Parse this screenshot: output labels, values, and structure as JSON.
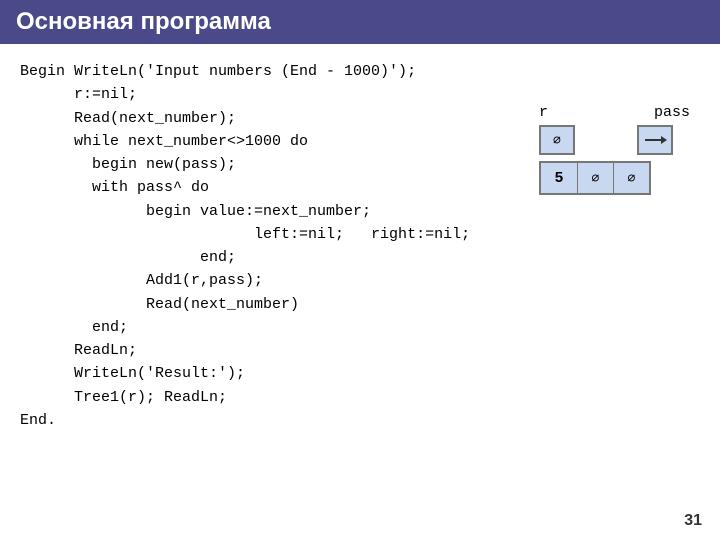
{
  "header": {
    "title": "Основная программа",
    "bg_color": "#4a4a8a"
  },
  "code": {
    "lines": [
      "Begin WriteLn('Input numbers (End - 1000)');",
      "      r:=nil;",
      "      Read(next_number);",
      "      while next_number<>1000 do",
      "        begin new(pass);",
      "        with pass^ do",
      "              begin value:=next_number;",
      "                          left:=nil;   right:=nil;",
      "                    end;",
      "              Add1(r,pass);",
      "              Read(next_number)",
      "        end;",
      "      ReadLn;",
      "      WriteLn('Result:');",
      "      Tree1(r); ReadLn;",
      "End."
    ]
  },
  "diagram": {
    "r_label": "r",
    "pass_label": "pass",
    "nil_symbol": "∅",
    "value": "5",
    "row1_box1": "∅",
    "row2_value": "5",
    "row2_nil1": "∅",
    "row2_nil2": "∅"
  },
  "page_number": "31"
}
